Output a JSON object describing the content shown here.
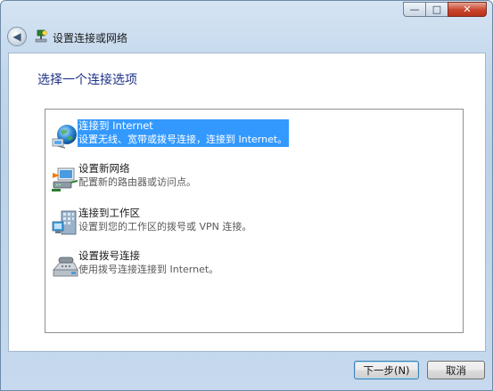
{
  "window": {
    "controls": {
      "minimize": "—",
      "maximize": "□",
      "close": "✕"
    }
  },
  "nav": {
    "title": "设置连接或网络",
    "back_glyph": "◀"
  },
  "page": {
    "heading": "选择一个连接选项"
  },
  "options": [
    {
      "title": "连接到 Internet",
      "desc": "设置无线、宽带或拨号连接，连接到 Internet。",
      "icon": "globe-network-icon",
      "selected": true
    },
    {
      "title": "设置新网络",
      "desc": "配置新的路由器或访问点。",
      "icon": "router-setup-icon",
      "selected": false
    },
    {
      "title": "连接到工作区",
      "desc": "设置到您的工作区的拨号或 VPN 连接。",
      "icon": "workplace-vpn-icon",
      "selected": false
    },
    {
      "title": "设置拨号连接",
      "desc": "使用拨号连接连接到 Internet。",
      "icon": "dialup-phone-icon",
      "selected": false
    }
  ],
  "buttons": {
    "next": "下一步(N)",
    "cancel": "取消"
  },
  "colors": {
    "selection": "#3399ff",
    "heading": "#1e3287",
    "close_button": "#c9442c"
  }
}
